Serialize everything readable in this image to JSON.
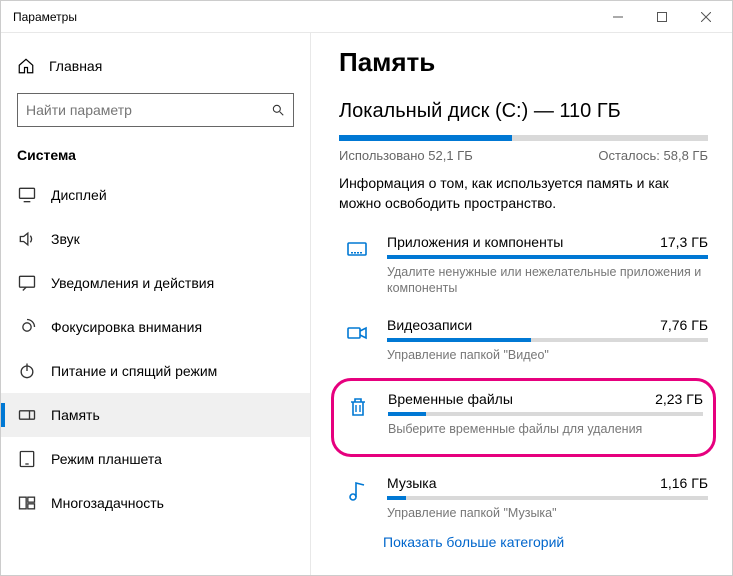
{
  "window": {
    "title": "Параметры"
  },
  "sidebar": {
    "home": "Главная",
    "search_placeholder": "Найти параметр",
    "section": "Система",
    "items": [
      {
        "label": "Дисплей"
      },
      {
        "label": "Звук"
      },
      {
        "label": "Уведомления и действия"
      },
      {
        "label": "Фокусировка внимания"
      },
      {
        "label": "Питание и спящий режим"
      },
      {
        "label": "Память"
      },
      {
        "label": "Режим планшета"
      },
      {
        "label": "Многозадачность"
      }
    ]
  },
  "content": {
    "page_title": "Память",
    "disk_title": "Локальный диск (C:) — 110 ГБ",
    "usage_pct": 47,
    "used_text": "Использовано 52,1 ГБ",
    "free_text": "Осталось: 58,8 ГБ",
    "info": "Информация о том, как используется память и как можно освободить пространство.",
    "categories": [
      {
        "name": "Приложения и компоненты",
        "size": "17,3 ГБ",
        "pct": 100,
        "desc": "Удалите ненужные или нежелательные приложения и компоненты"
      },
      {
        "name": "Видеозаписи",
        "size": "7,76 ГБ",
        "pct": 45,
        "desc": "Управление папкой \"Видео\""
      },
      {
        "name": "Временные файлы",
        "size": "2,23 ГБ",
        "pct": 12,
        "desc": "Выберите временные файлы для удаления"
      },
      {
        "name": "Музыка",
        "size": "1,16 ГБ",
        "pct": 6,
        "desc": "Управление папкой \"Музыка\""
      }
    ],
    "show_more": "Показать больше категорий"
  }
}
